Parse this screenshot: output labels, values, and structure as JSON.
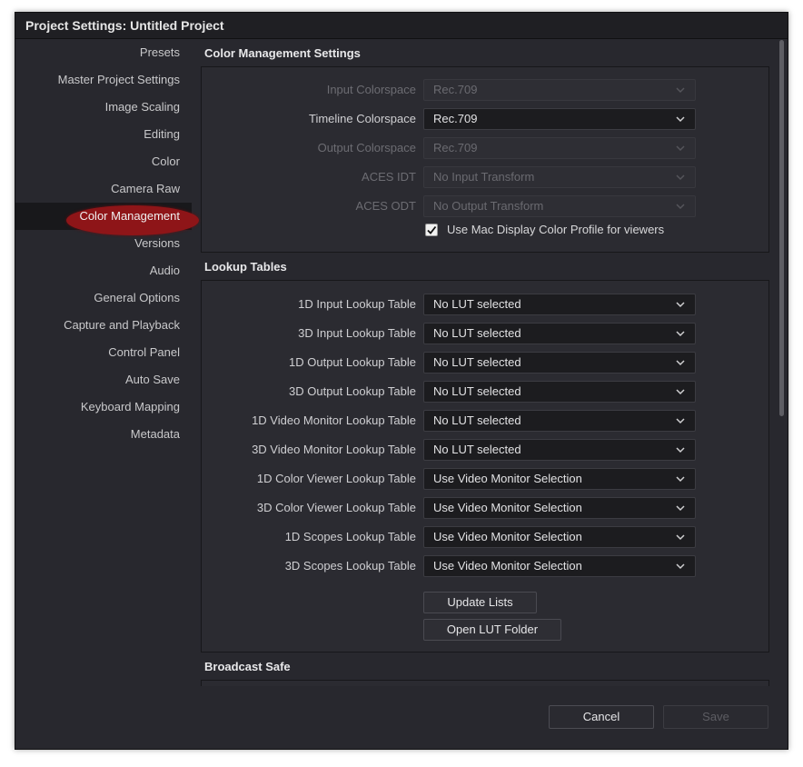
{
  "window": {
    "title": "Project Settings:  Untitled Project"
  },
  "sidebar": {
    "items": [
      {
        "label": "Presets"
      },
      {
        "label": "Master Project Settings"
      },
      {
        "label": "Image Scaling"
      },
      {
        "label": "Editing"
      },
      {
        "label": "Color"
      },
      {
        "label": "Camera Raw"
      },
      {
        "label": "Color Management",
        "selected": true
      },
      {
        "label": "Versions"
      },
      {
        "label": "Audio"
      },
      {
        "label": "General Options"
      },
      {
        "label": "Capture and Playback"
      },
      {
        "label": "Control Panel"
      },
      {
        "label": "Auto Save"
      },
      {
        "label": "Keyboard Mapping"
      },
      {
        "label": "Metadata"
      }
    ]
  },
  "color_management": {
    "title": "Color Management Settings",
    "rows": [
      {
        "label": "Input Colorspace",
        "value": "Rec.709",
        "enabled": false
      },
      {
        "label": "Timeline Colorspace",
        "value": "Rec.709",
        "enabled": true
      },
      {
        "label": "Output Colorspace",
        "value": "Rec.709",
        "enabled": false
      },
      {
        "label": "ACES IDT",
        "value": "No Input Transform",
        "enabled": false
      },
      {
        "label": "ACES ODT",
        "value": "No Output Transform",
        "enabled": false
      }
    ],
    "mac_profile": {
      "label": "Use Mac Display Color Profile for viewers",
      "checked": true
    }
  },
  "lookup_tables": {
    "title": "Lookup Tables",
    "rows": [
      {
        "label": "1D Input Lookup Table",
        "value": "No LUT selected"
      },
      {
        "label": "3D Input Lookup Table",
        "value": "No LUT selected"
      },
      {
        "label": "1D Output Lookup Table",
        "value": "No LUT selected"
      },
      {
        "label": "3D Output Lookup Table",
        "value": "No LUT selected"
      },
      {
        "label": "1D Video Monitor Lookup Table",
        "value": "No LUT selected"
      },
      {
        "label": "3D Video Monitor Lookup Table",
        "value": "No LUT selected"
      },
      {
        "label": "1D Color Viewer Lookup Table",
        "value": "Use Video Monitor Selection"
      },
      {
        "label": "3D Color Viewer Lookup Table",
        "value": "Use Video Monitor Selection"
      },
      {
        "label": "1D Scopes Lookup Table",
        "value": "Use Video Monitor Selection"
      },
      {
        "label": "3D Scopes Lookup Table",
        "value": "Use Video Monitor Selection"
      }
    ],
    "update_lists": "Update Lists",
    "open_lut_folder": "Open LUT Folder"
  },
  "broadcast_safe": {
    "title": "Broadcast Safe"
  },
  "footer": {
    "cancel": "Cancel",
    "save": "Save"
  },
  "colors": {
    "highlight": "#8e1518",
    "background": "#28282e"
  }
}
